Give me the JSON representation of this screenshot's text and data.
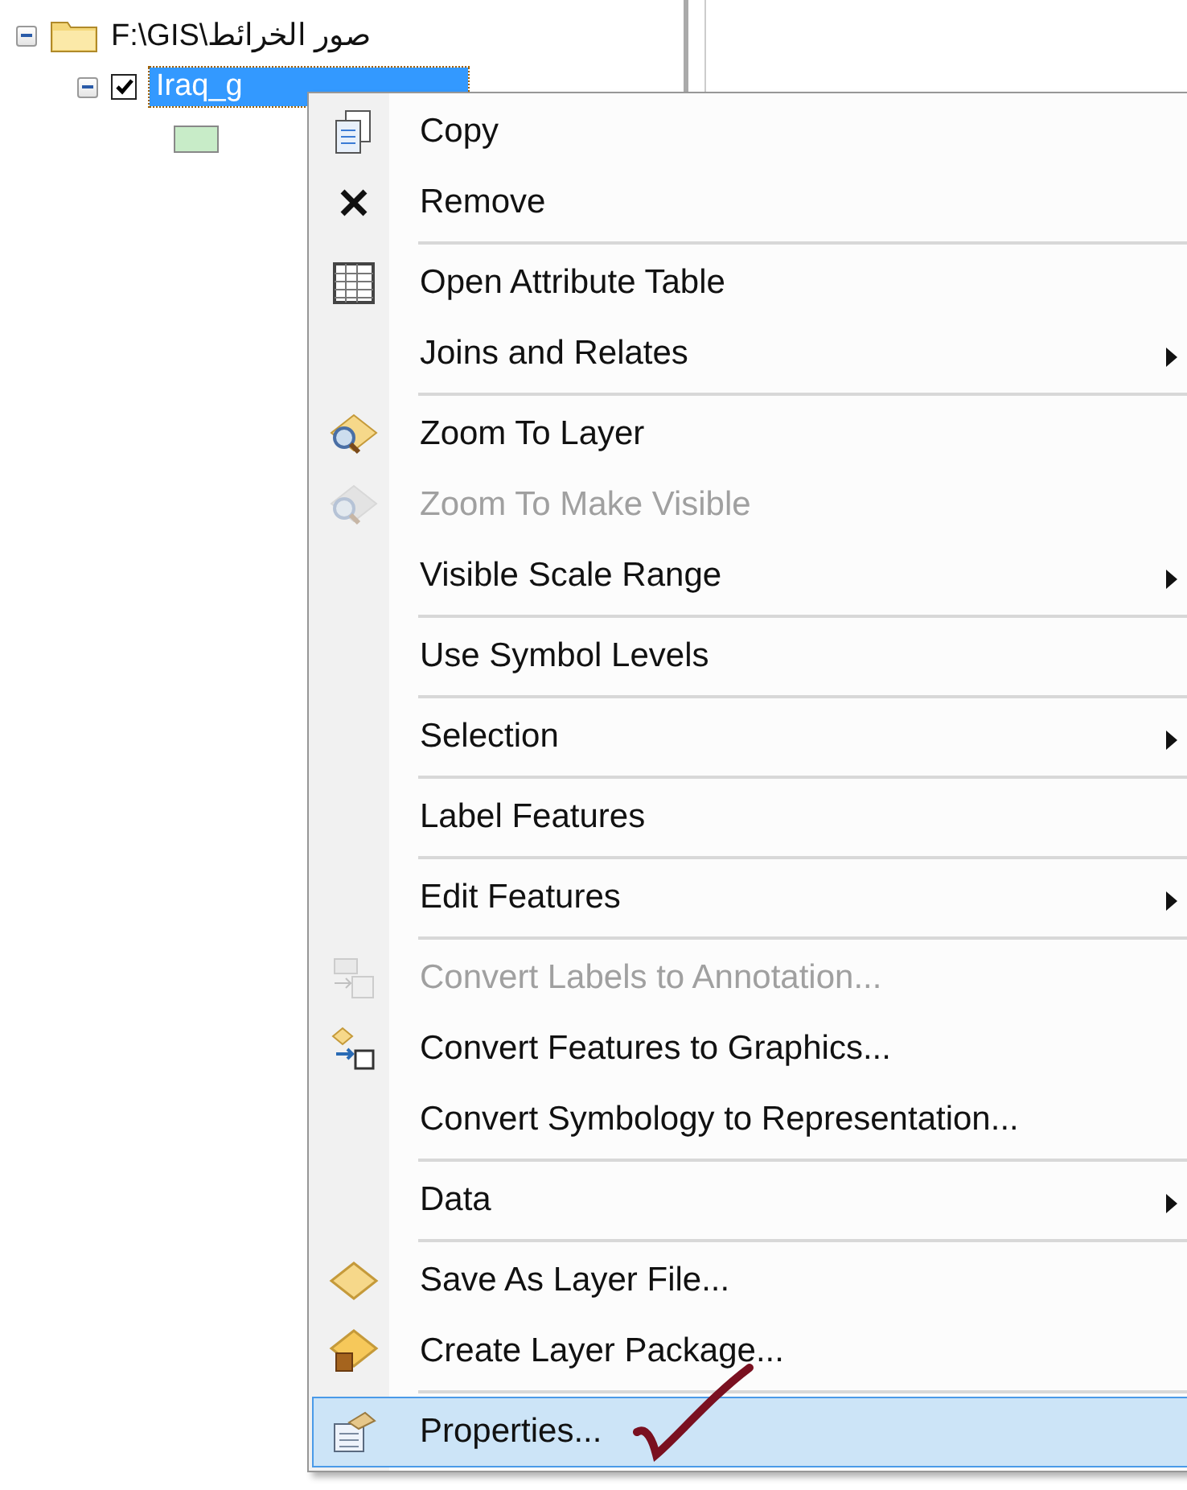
{
  "tree": {
    "root": {
      "label": "F:\\GIS\\صور الخرائط",
      "expanded": true
    },
    "layer": {
      "label": "Iraq_g",
      "checked": true,
      "expanded": true,
      "selected": true
    }
  },
  "context_menu": {
    "groups": [
      [
        {
          "label": "Copy",
          "disabled": false,
          "submenu": false,
          "selected": false
        },
        {
          "label": "Remove",
          "disabled": false,
          "submenu": false,
          "selected": false
        }
      ],
      [
        {
          "label": "Open Attribute Table",
          "disabled": false,
          "submenu": false,
          "selected": false
        },
        {
          "label": "Joins and Relates",
          "disabled": false,
          "submenu": true,
          "selected": false
        }
      ],
      [
        {
          "label": "Zoom To Layer",
          "disabled": false,
          "submenu": false,
          "selected": false
        },
        {
          "label": "Zoom To Make Visible",
          "disabled": true,
          "submenu": false,
          "selected": false
        },
        {
          "label": "Visible Scale Range",
          "disabled": false,
          "submenu": true,
          "selected": false
        }
      ],
      [
        {
          "label": "Use Symbol Levels",
          "disabled": false,
          "submenu": false,
          "selected": false
        }
      ],
      [
        {
          "label": "Selection",
          "disabled": false,
          "submenu": true,
          "selected": false
        }
      ],
      [
        {
          "label": "Label Features",
          "disabled": false,
          "submenu": false,
          "selected": false
        }
      ],
      [
        {
          "label": "Edit Features",
          "disabled": false,
          "submenu": true,
          "selected": false
        }
      ],
      [
        {
          "label": "Convert Labels to Annotation...",
          "disabled": true,
          "submenu": false,
          "selected": false
        },
        {
          "label": "Convert Features to Graphics...",
          "disabled": false,
          "submenu": false,
          "selected": false
        },
        {
          "label": "Convert Symbology to Representation...",
          "disabled": false,
          "submenu": false,
          "selected": false
        }
      ],
      [
        {
          "label": "Data",
          "disabled": false,
          "submenu": true,
          "selected": false
        }
      ],
      [
        {
          "label": "Save As Layer File...",
          "disabled": false,
          "submenu": false,
          "selected": false
        },
        {
          "label": "Create Layer Package...",
          "disabled": false,
          "submenu": false,
          "selected": false
        }
      ],
      [
        {
          "label": "Properties...",
          "disabled": false,
          "submenu": false,
          "selected": true
        }
      ]
    ]
  }
}
